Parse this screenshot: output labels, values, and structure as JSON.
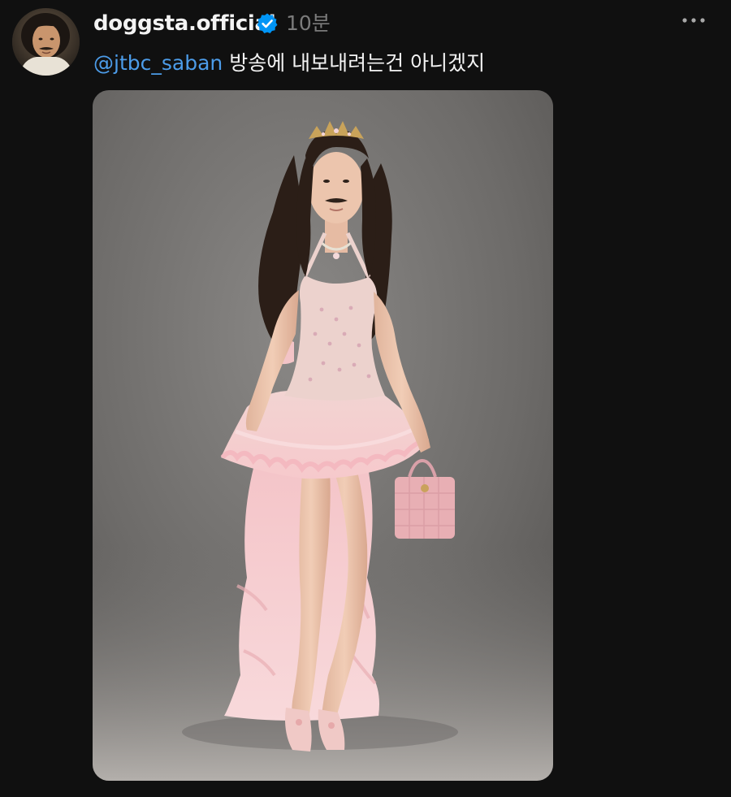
{
  "post": {
    "username": "doggsta.official",
    "timestamp": "10분",
    "caption": {
      "mention": "@jtbc_saban",
      "text": " 방송에 내보내려는건 아니겠지"
    }
  },
  "icons": {
    "verified": "verified-badge-icon",
    "more": "more-options-icon"
  },
  "colors": {
    "background": "#101010",
    "text": "#f3f3f3",
    "muted": "#7b7b7b",
    "mention": "#4c9ce9",
    "verified": "#0095f6"
  }
}
